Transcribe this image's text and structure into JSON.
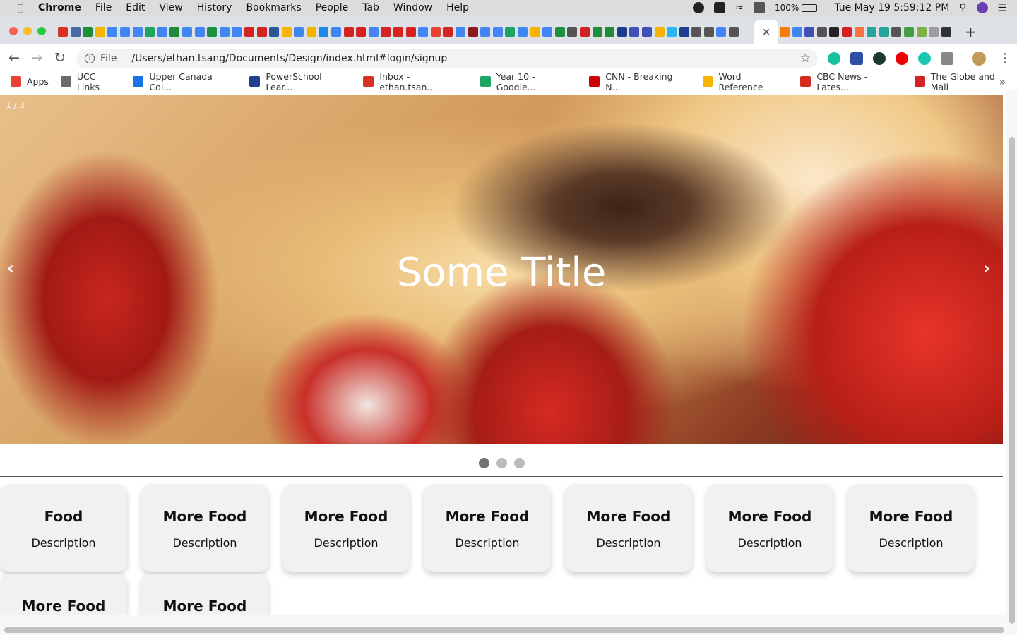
{
  "menubar": {
    "app": "Chrome",
    "items": [
      "File",
      "Edit",
      "View",
      "History",
      "Bookmarks",
      "People",
      "Tab",
      "Window",
      "Help"
    ],
    "battery": "100%",
    "datetime": "Tue May 19  5:59:12 PM"
  },
  "tabs": {
    "active_close": "×",
    "new_tab": "+"
  },
  "toolbar": {
    "back": "←",
    "forward": "→",
    "reload": "↻",
    "info": "i",
    "scheme_label": "File",
    "url": "/Users/ethan.tsang/Documents/Design/index.html#login/signup",
    "star": "☆",
    "menu": "⋮"
  },
  "bookmarks": {
    "items": [
      {
        "label": "Apps",
        "color": "#e94235"
      },
      {
        "label": "UCC Links",
        "color": "#6b6b6b"
      },
      {
        "label": "Upper Canada Col...",
        "color": "#1a73e8"
      },
      {
        "label": "PowerSchool Lear...",
        "color": "#1f3f8f"
      },
      {
        "label": "Inbox - ethan.tsan...",
        "color": "#d93025"
      },
      {
        "label": "Year 10 - Google...",
        "color": "#1fa463"
      },
      {
        "label": "CNN - Breaking N...",
        "color": "#cc0000"
      },
      {
        "label": "Word Reference",
        "color": "#f4b400"
      },
      {
        "label": "CBC News - Lates...",
        "color": "#d52b1e"
      },
      {
        "label": "The Globe and Mail",
        "color": "#d32323"
      }
    ],
    "more": "»"
  },
  "carousel": {
    "counter": "1 / 3",
    "title": "Some Title",
    "prev": "‹",
    "next": "›",
    "slides": 3,
    "active_index": 0
  },
  "cards": [
    {
      "title": "Food",
      "description": "Description"
    },
    {
      "title": "More Food",
      "description": "Description"
    },
    {
      "title": "More Food",
      "description": "Description"
    },
    {
      "title": "More Food",
      "description": "Description"
    },
    {
      "title": "More Food",
      "description": "Description"
    },
    {
      "title": "More Food",
      "description": "Description"
    },
    {
      "title": "More Food",
      "description": "Description"
    },
    {
      "title": "More Food",
      "description": ""
    },
    {
      "title": "More Food",
      "description": ""
    }
  ]
}
